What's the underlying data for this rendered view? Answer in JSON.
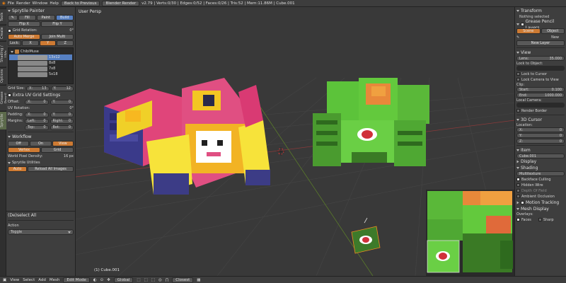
{
  "topbar": {
    "menus": [
      "File",
      "Render",
      "Window",
      "Help"
    ],
    "back_label": "Back to Previous",
    "engine": "Blender Render",
    "stats": "v2.79 | Verts:0/30 | Edges:0/52 | Faces:0/26 | Tris:52 | Mem:11.86M | Cube.001"
  },
  "left_tabs": [
    "Tools",
    "Create",
    "Shading / UVs",
    "Options",
    "Grease Pencil",
    "Sprytile"
  ],
  "left_panel": {
    "title": "Sprytile Painter",
    "modes": [
      "Paint",
      "Fill",
      "Build"
    ],
    "mode_extra": "Build",
    "flip_x": "Flip X",
    "flip_y": "Flip Y",
    "grid_rotation_label": "Grid Rotation:",
    "grid_rotation_value": "0°",
    "auto_merge": "Auto Merge",
    "join_multi": "Join Multi",
    "lock_label": "Lock:",
    "lock_axes": [
      "X",
      "Y",
      "Z"
    ],
    "material_name": "ChibiMuse",
    "grids": [
      "13x12",
      "8x8",
      "7x8",
      "5x18"
    ],
    "grid_size_label": "Grid Size:",
    "grid_size_x_label": "X:",
    "grid_size_x": "13",
    "grid_size_y_label": "Y:",
    "grid_size_y": "12",
    "extra_uv": "Extra UV Grid Settings",
    "offset_label": "Offset:",
    "offset_x": "0",
    "offset_y": "0",
    "uv_rotation_label": "UV Rotation:",
    "uv_rotation_value": "0°",
    "padding_label": "Padding:",
    "padding_x": "0",
    "padding_y": "0",
    "margins_label": "Margins:",
    "margin_left_label": "Left:",
    "margin_left": "0",
    "margin_right_label": "Right:",
    "margin_right": "0",
    "margin_top_label": "Top:",
    "margin_top": "0",
    "margin_bottom_label": "Bot:",
    "margin_bottom": "0",
    "workflow_title": "Workflow",
    "workflow_buttons": [
      "Off",
      "On",
      "View"
    ],
    "snap_buttons": [
      "Vertex",
      "Grid"
    ],
    "world_pixel_label": "World Pixel Density:",
    "world_pixel_value": "16 px",
    "upgrade_label": "Sprytile Utilities",
    "auto_label": "Auto",
    "reload_label": "Reload All Images"
  },
  "operator": {
    "title": "(De)select All",
    "action_label": "Action",
    "action_value": "Toggle"
  },
  "viewport": {
    "label": "User Persp",
    "object_label": "(1) Cube.001"
  },
  "right_panel": {
    "transform": "Transform",
    "nothing_selected": "Nothing selected",
    "grease_pencil_layers": "Grease Pencil Layers",
    "scene_tab": "Scene",
    "object_tab": "Object",
    "new_label": "New",
    "new_layer": "New Layer",
    "view_title": "View",
    "lens_label": "Lens:",
    "lens_value": "35.000",
    "lock_to_object": "Lock to Object:",
    "lock_to_cursor": "Lock to Cursor",
    "lock_camera": "Lock Camera to View",
    "clip_label": "Clip:",
    "clip_start_label": "Start:",
    "clip_start": "0.100",
    "clip_end_label": "End:",
    "clip_end": "1000.000",
    "local_camera": "Local Camera:",
    "render_border": "Render Border",
    "cursor_title": "3D Cursor",
    "location_label": "Location:",
    "loc_x_label": "X:",
    "loc_x": "0",
    "loc_y_label": "Y:",
    "loc_y": "0",
    "loc_z_label": "Z:",
    "loc_z": "0",
    "item_title": "Item",
    "item_value": "Cube.001",
    "display_title": "Display",
    "shading_title": "Shading",
    "shading_value": "Multitexture",
    "backface_culling": "Backface Culling",
    "hidden_wire": "Hidden Wire",
    "depth_of_field": "Depth Of Field",
    "ambient_occlusion": "Ambient Occlusion",
    "motion_tracking": "Motion Tracking",
    "mesh_display": "Mesh Display",
    "overlays": "Overlays:",
    "faces": "Faces",
    "sharp": "Sharp"
  },
  "bottombar": {
    "items": [
      "View",
      "Select",
      "Add",
      "Mesh"
    ],
    "mode": "Edit Mode",
    "pivot": "Global",
    "snap": "Closest"
  }
}
